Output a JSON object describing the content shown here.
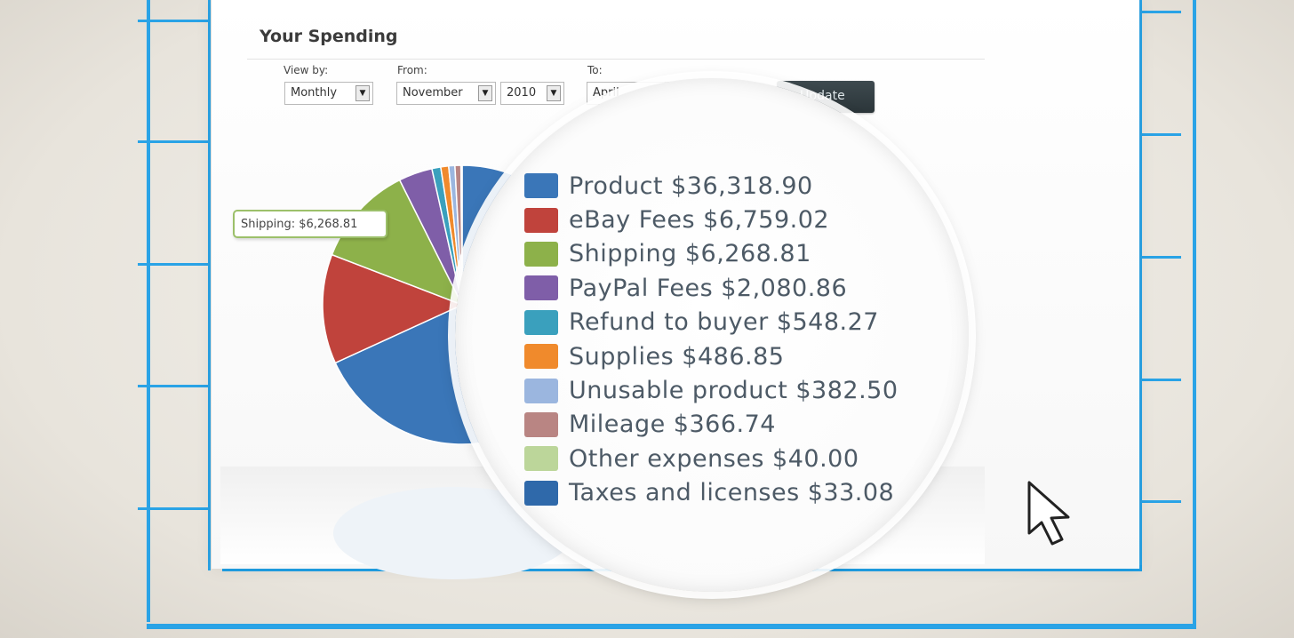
{
  "page": {
    "title": "Your Spending"
  },
  "filters": {
    "view_by_label": "View by:",
    "view_by_value": "Monthly",
    "from_label": "From:",
    "from_month_value": "November",
    "from_year_value": "2010",
    "to_label": "To:",
    "to_month_value": "April",
    "update_label": "Update"
  },
  "tooltip": {
    "text": "Shipping: $6,268.81"
  },
  "chart_data": {
    "type": "pie",
    "slices": [
      {
        "label": "Product $36,318.90",
        "category": "Product",
        "value": 36318.9,
        "color": "#3a76b8"
      },
      {
        "label": "eBay Fees $6,759.02",
        "category": "eBay Fees",
        "value": 6759.02,
        "color": "#c0433c"
      },
      {
        "label": "Shipping $6,268.81",
        "category": "Shipping",
        "value": 6268.81,
        "color": "#8db14a"
      },
      {
        "label": "PayPal Fees $2,080.86",
        "category": "PayPal Fees",
        "value": 2080.86,
        "color": "#7f5ea8"
      },
      {
        "label": "Refund to buyer $548.27",
        "category": "Refund to buyer",
        "value": 548.27,
        "color": "#3aa0bd"
      },
      {
        "label": "Supplies $486.85",
        "category": "Supplies",
        "value": 486.85,
        "color": "#f08a2c"
      },
      {
        "label": "Unusable product $382.50",
        "category": "Unusable product",
        "value": 382.5,
        "color": "#9bb6df"
      },
      {
        "label": "Mileage $366.74",
        "category": "Mileage",
        "value": 366.74,
        "color": "#b98583"
      },
      {
        "label": "Other expenses $40.00",
        "category": "Other expenses",
        "value": 40.0,
        "color": "#bcd69a"
      },
      {
        "label": "Taxes and licenses $33.08",
        "category": "Taxes and licenses",
        "value": 33.08,
        "color": "#2f69aa"
      }
    ],
    "legend_position": "right",
    "highlighted": "Shipping"
  }
}
